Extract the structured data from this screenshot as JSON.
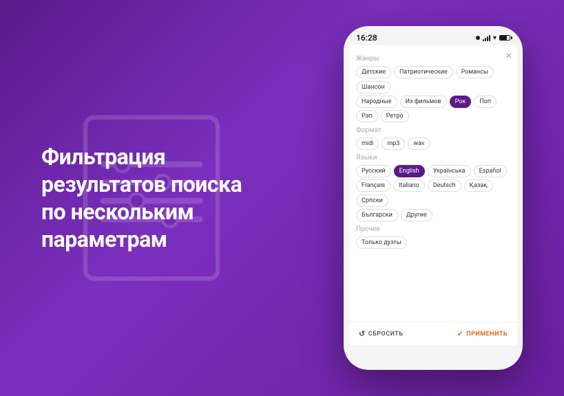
{
  "background": {
    "gradient_start": "#5a1a8a",
    "gradient_end": "#7b2fbe"
  },
  "left": {
    "title": "Фильтрация результатов поиска по нескольким параметрам"
  },
  "phone": {
    "status_bar": {
      "time": "16:28",
      "dot_label": "camera"
    },
    "close_label": "×",
    "sections": [
      {
        "id": "genres",
        "label": "Жанры",
        "rows": [
          [
            "Детские",
            "Патриотические",
            "Романсы",
            "Шансон"
          ],
          [
            "Народные",
            "Из фильмов",
            "Рок",
            "Поп"
          ],
          [
            "Рэп",
            "Ретро"
          ]
        ],
        "active": [
          "Рок"
        ]
      },
      {
        "id": "format",
        "label": "Формат",
        "rows": [
          [
            "midi",
            "mp3",
            "wav"
          ]
        ],
        "active": []
      },
      {
        "id": "languages",
        "label": "Языки",
        "rows": [
          [
            "Русский",
            "English",
            "Українська",
            "Español"
          ],
          [
            "Français",
            "Italiano",
            "Deutsch",
            "Қазақ",
            "Српски"
          ],
          [
            "Български",
            "Другие"
          ]
        ],
        "active": [
          "English"
        ]
      },
      {
        "id": "other",
        "label": "Прочее",
        "rows": [
          [
            "Только дуэты"
          ]
        ],
        "active": []
      }
    ],
    "footer": {
      "reset_label": "СБРОСИТЬ",
      "apply_label": "ПРИМЕНИТЬ"
    }
  }
}
